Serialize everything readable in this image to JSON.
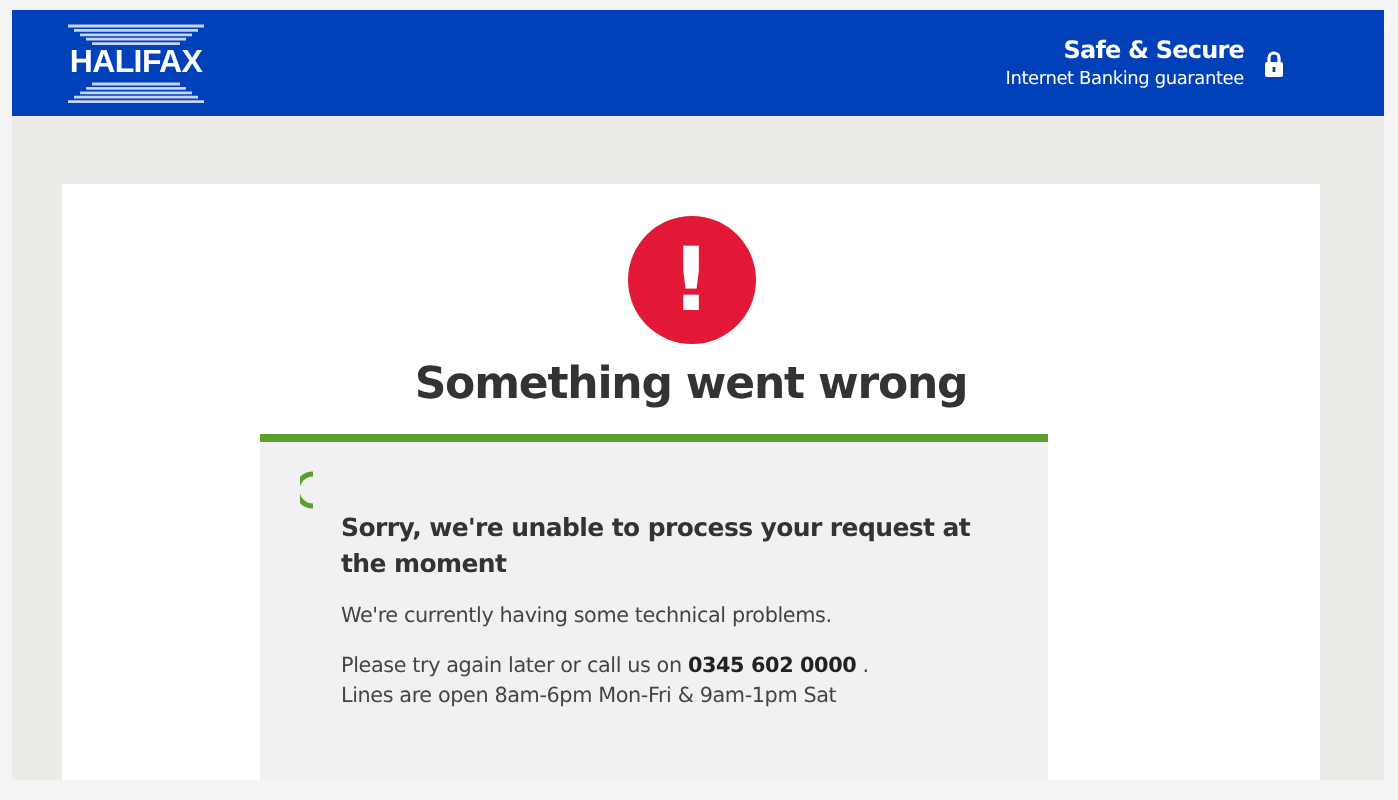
{
  "header": {
    "logo": "HALIFAX",
    "title": "Safe & Secure",
    "subtitle": "Internet Banking guarantee"
  },
  "error": {
    "icon": "!",
    "heading": "Something went wrong"
  },
  "message": {
    "title": "Sorry, we're unable to process your request at the moment",
    "paragraphs": [
      [
        "We're currently having some technical problems."
      ],
      [
        "Please try again later or call us on **0345 602 0000** .",
        "Lines are open 8am-6pm Mon-Fri & 9am-1pm Sat"
      ]
    ]
  }
}
